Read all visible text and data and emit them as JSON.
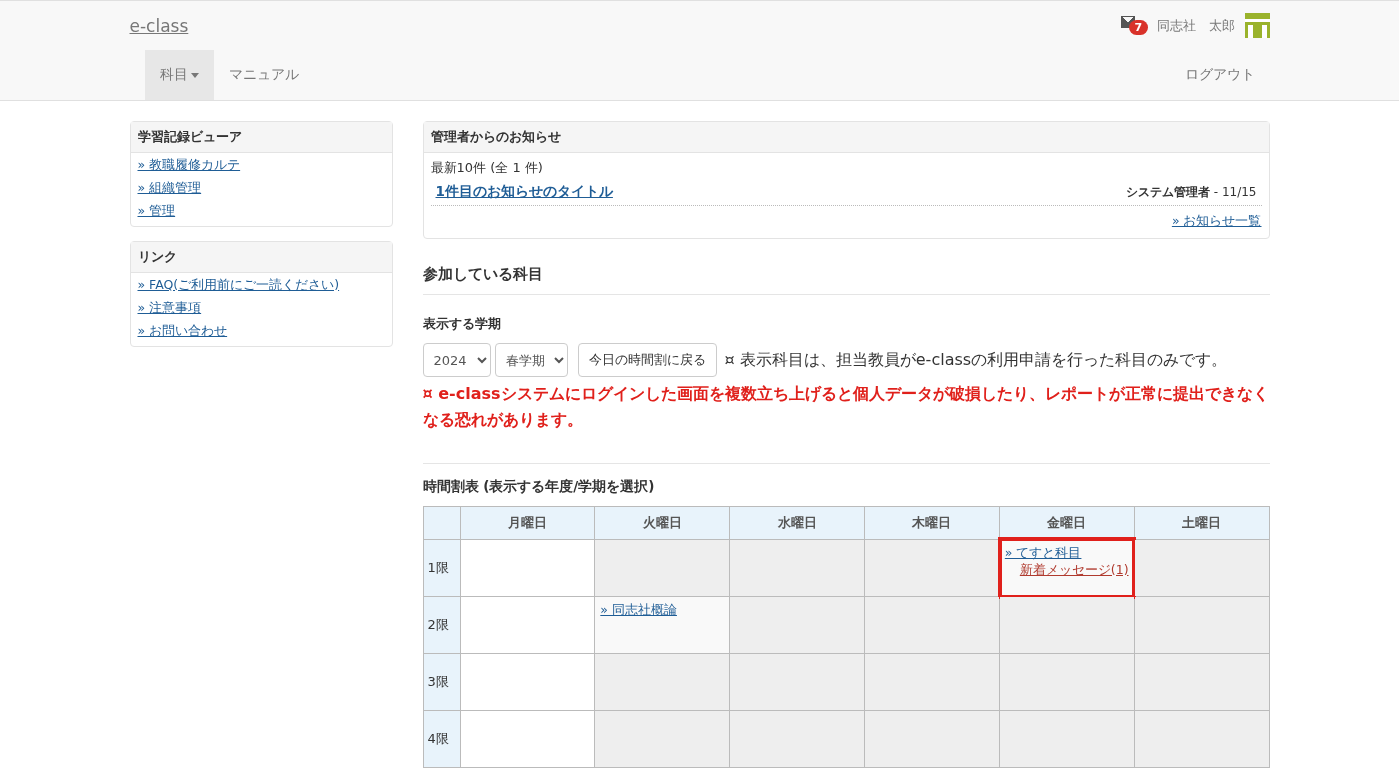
{
  "header": {
    "logo": "e-class",
    "mail_count": "7",
    "user_name": "同志社　太郎",
    "logout": "ログアウト"
  },
  "nav": [
    {
      "label": "科目",
      "dropdown": true,
      "selected": true
    },
    {
      "label": "マニュアル",
      "dropdown": false,
      "selected": false
    }
  ],
  "sidebar": [
    {
      "title": "学習記録ビューア",
      "links": [
        "» 教職履修カルテ",
        "» 組織管理",
        "» 管理"
      ]
    },
    {
      "title": "リンク",
      "links": [
        "» FAQ(ご利用前にご一読ください)",
        "» 注意事項",
        "» お問い合わせ"
      ]
    }
  ],
  "notices": {
    "title": "管理者からのお知らせ",
    "summary": "最新10件 (全 1 件)",
    "items": [
      {
        "title": "1件目のお知らせのタイトル",
        "author": "システム管理者",
        "date": " - 11/15"
      }
    ],
    "more": "» お知らせ一覧"
  },
  "courses": {
    "heading": "参加している科目",
    "term_label": "表示する学期",
    "year": "2024",
    "term": "春学期",
    "today_button": "今日の時間割に戻る",
    "note": "¤ 表示科目は、担当教員がe-classの利用申請を行った科目のみです。",
    "warning": "¤ e-classシステムにログインした画面を複数立ち上げると個人データが破損したり、レポートが正常に提出できなくなる恐れがあります。"
  },
  "timetable": {
    "title": "時間割表 (表示する年度/学期を選択)",
    "columns": [
      "月曜日",
      "火曜日",
      "水曜日",
      "木曜日",
      "金曜日",
      "土曜日"
    ],
    "rows": [
      {
        "period": "1限",
        "cells": [
          {
            "kind": "blank",
            "highlighted": false
          },
          {
            "kind": "closed",
            "highlighted": false
          },
          {
            "kind": "closed",
            "highlighted": false
          },
          {
            "kind": "closed",
            "highlighted": false
          },
          {
            "kind": "course",
            "course": "» てすと科目",
            "message": "新着メッセージ(1)",
            "highlighted": true
          },
          {
            "kind": "closed",
            "highlighted": false
          }
        ]
      },
      {
        "period": "2限",
        "cells": [
          {
            "kind": "blank",
            "highlighted": false
          },
          {
            "kind": "course",
            "course": "» 同志社概論",
            "highlighted": false
          },
          {
            "kind": "closed",
            "highlighted": false
          },
          {
            "kind": "closed",
            "highlighted": false
          },
          {
            "kind": "closed",
            "highlighted": false
          },
          {
            "kind": "closed",
            "highlighted": false
          }
        ]
      },
      {
        "period": "3限",
        "cells": [
          {
            "kind": "blank",
            "highlighted": false
          },
          {
            "kind": "closed",
            "highlighted": false
          },
          {
            "kind": "closed",
            "highlighted": false
          },
          {
            "kind": "closed",
            "highlighted": false
          },
          {
            "kind": "closed",
            "highlighted": false
          },
          {
            "kind": "closed",
            "highlighted": false
          }
        ]
      },
      {
        "period": "4限",
        "cells": [
          {
            "kind": "blank",
            "highlighted": false
          },
          {
            "kind": "closed",
            "highlighted": false
          },
          {
            "kind": "closed",
            "highlighted": false
          },
          {
            "kind": "closed",
            "highlighted": false
          },
          {
            "kind": "closed",
            "highlighted": false
          },
          {
            "kind": "closed",
            "highlighted": false
          }
        ]
      }
    ]
  }
}
